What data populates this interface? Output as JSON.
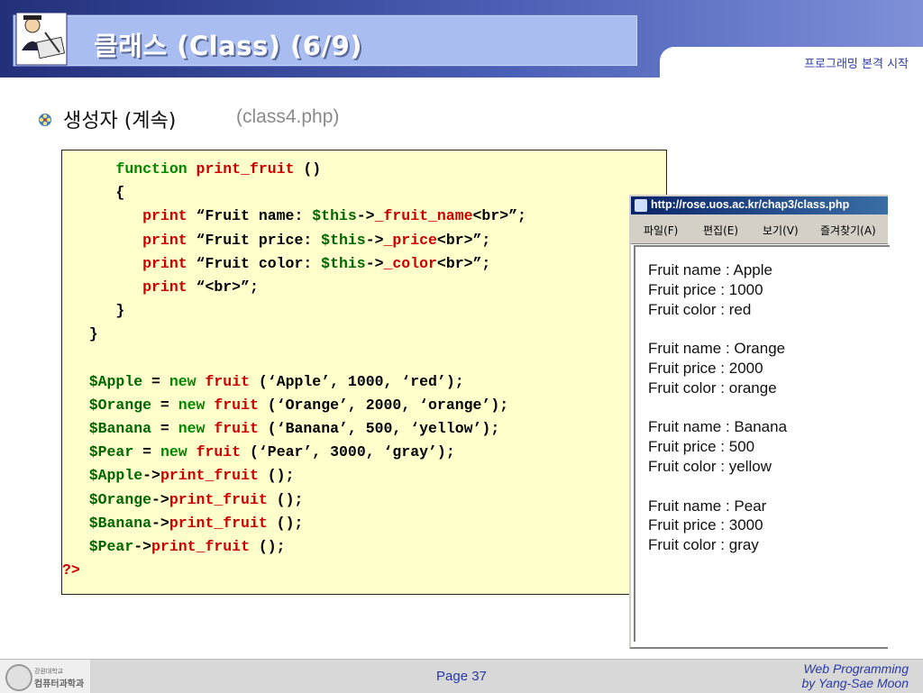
{
  "header": {
    "title": "클래스 (Class) (6/9)",
    "subtitle": "프로그래밍 본격 시작"
  },
  "bullet": {
    "text": "생성자 (계속)",
    "file": "(class4.php)"
  },
  "code": [
    [
      {
        "t": "      "
      },
      {
        "t": "function",
        "c": "kw-green"
      },
      {
        "t": " "
      },
      {
        "t": "print_fruit",
        "c": "kw-red"
      },
      {
        "t": " ()"
      }
    ],
    [
      {
        "t": "      {"
      }
    ],
    [
      {
        "t": "         "
      },
      {
        "t": "print",
        "c": "kw-red"
      },
      {
        "t": " “Fruit name: "
      },
      {
        "t": "$this",
        "c": "var"
      },
      {
        "t": "->"
      },
      {
        "t": "_fruit_name",
        "c": "kw-red"
      },
      {
        "t": "<br>”;"
      }
    ],
    [
      {
        "t": "         "
      },
      {
        "t": "print",
        "c": "kw-red"
      },
      {
        "t": " “Fruit price: "
      },
      {
        "t": "$this",
        "c": "var"
      },
      {
        "t": "->"
      },
      {
        "t": "_price",
        "c": "kw-red"
      },
      {
        "t": "<br>”;"
      }
    ],
    [
      {
        "t": "         "
      },
      {
        "t": "print",
        "c": "kw-red"
      },
      {
        "t": " “Fruit color: "
      },
      {
        "t": "$this",
        "c": "var"
      },
      {
        "t": "->"
      },
      {
        "t": "_color",
        "c": "kw-red"
      },
      {
        "t": "<br>”;"
      }
    ],
    [
      {
        "t": "         "
      },
      {
        "t": "print",
        "c": "kw-red"
      },
      {
        "t": " “<br>”;"
      }
    ],
    [
      {
        "t": "      }"
      }
    ],
    [
      {
        "t": "   }"
      }
    ],
    [
      {
        "t": ""
      }
    ],
    [
      {
        "t": "   "
      },
      {
        "t": "$Apple",
        "c": "var"
      },
      {
        "t": " = "
      },
      {
        "t": "new",
        "c": "kw-green"
      },
      {
        "t": " "
      },
      {
        "t": "fruit",
        "c": "kw-red"
      },
      {
        "t": " (‘Apple’, 1000, ‘red’);"
      }
    ],
    [
      {
        "t": "   "
      },
      {
        "t": "$Orange",
        "c": "var"
      },
      {
        "t": " = "
      },
      {
        "t": "new",
        "c": "kw-green"
      },
      {
        "t": " "
      },
      {
        "t": "fruit",
        "c": "kw-red"
      },
      {
        "t": " (‘Orange’, 2000, ‘orange’);"
      }
    ],
    [
      {
        "t": "   "
      },
      {
        "t": "$Banana",
        "c": "var"
      },
      {
        "t": " = "
      },
      {
        "t": "new",
        "c": "kw-green"
      },
      {
        "t": " "
      },
      {
        "t": "fruit",
        "c": "kw-red"
      },
      {
        "t": " (‘Banana’, 500, ‘yellow’);"
      }
    ],
    [
      {
        "t": "   "
      },
      {
        "t": "$Pear",
        "c": "var"
      },
      {
        "t": " = "
      },
      {
        "t": "new",
        "c": "kw-green"
      },
      {
        "t": " "
      },
      {
        "t": "fruit",
        "c": "kw-red"
      },
      {
        "t": " (‘Pear’, 3000, ‘gray’);"
      }
    ],
    [
      {
        "t": "   "
      },
      {
        "t": "$Apple",
        "c": "var"
      },
      {
        "t": "->"
      },
      {
        "t": "print_fruit",
        "c": "kw-red"
      },
      {
        "t": " ();"
      }
    ],
    [
      {
        "t": "   "
      },
      {
        "t": "$Orange",
        "c": "var"
      },
      {
        "t": "->"
      },
      {
        "t": "print_fruit",
        "c": "kw-red"
      },
      {
        "t": " ();"
      }
    ],
    [
      {
        "t": "   "
      },
      {
        "t": "$Banana",
        "c": "var"
      },
      {
        "t": "->"
      },
      {
        "t": "print_fruit",
        "c": "kw-red"
      },
      {
        "t": " ();"
      }
    ],
    [
      {
        "t": "   "
      },
      {
        "t": "$Pear",
        "c": "var"
      },
      {
        "t": "->"
      },
      {
        "t": "print_fruit",
        "c": "kw-red"
      },
      {
        "t": " ();"
      }
    ],
    [
      {
        "t": "?>",
        "c": "kw-red"
      }
    ]
  ],
  "browser": {
    "url": "http://rose.uos.ac.kr/chap3/class.php",
    "menu": [
      "파일(F)",
      "편집(E)",
      "보기(V)",
      "즐겨찾기(A)"
    ],
    "output": [
      "Fruit name : Apple",
      "Fruit price : 1000",
      "Fruit color : red",
      "",
      "Fruit name : Orange",
      "Fruit price : 2000",
      "Fruit color : orange",
      "",
      "Fruit name : Banana",
      "Fruit price : 500",
      "Fruit color : yellow",
      "",
      "Fruit name : Pear",
      "Fruit price : 3000",
      "Fruit color : gray"
    ]
  },
  "footer": {
    "org_line1": "강원대학교",
    "org_line2": "컴퓨터과학과",
    "page": "Page 37",
    "credit_line1": "Web Programming",
    "credit_line2": "by Yang-Sae Moon"
  },
  "colors": {
    "code_background": "#ffffcc",
    "keyword_green": "#008800",
    "keyword_red": "#cc0000",
    "accent_blue": "#2a3aa8"
  }
}
